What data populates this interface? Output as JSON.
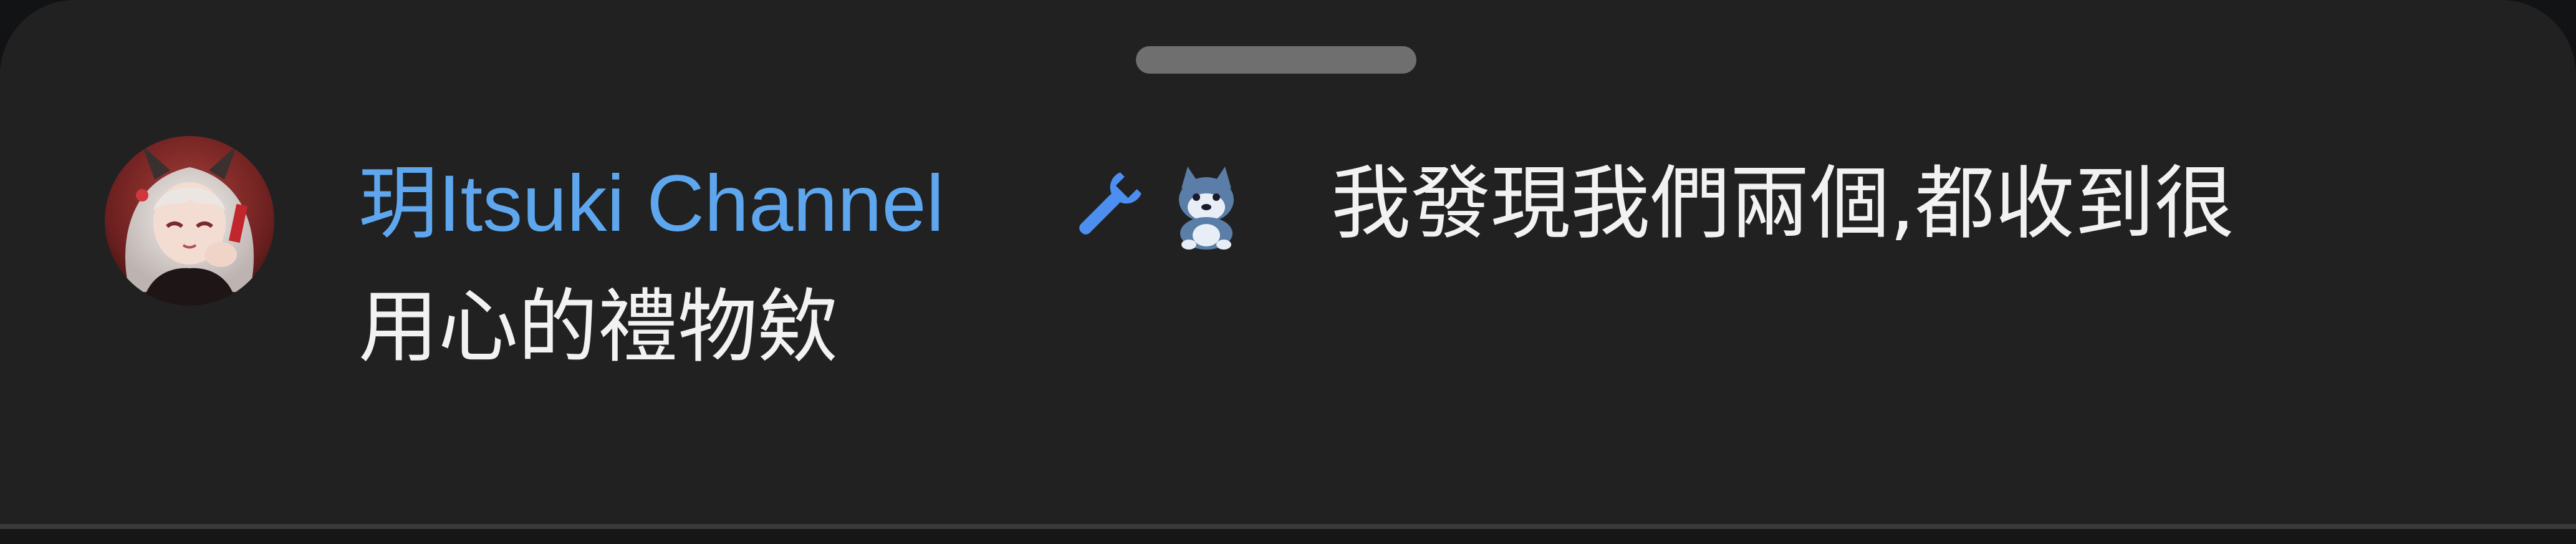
{
  "sheet": {
    "background": "#212121",
    "handle_color": "#6f6f6f"
  },
  "comment": {
    "author": "玥Itsuki Channel",
    "author_color": "#5ea7ef",
    "badges": [
      "wrench-icon",
      "husky-emoji-icon"
    ],
    "text_line_1": "我發現我們兩個,都收到很",
    "text_line_2": "用心的禮物欸",
    "text_color": "#f2f2f2"
  },
  "icons": {
    "wrench_color": "#4d8ff0",
    "husky_body": "#5a7ea8"
  }
}
